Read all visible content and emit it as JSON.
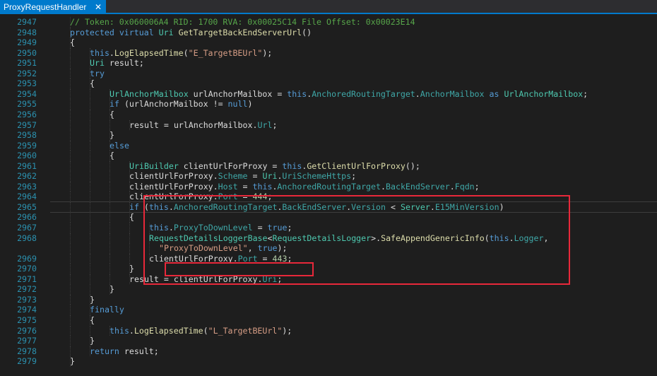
{
  "tab": {
    "title": "ProxyRequestHandler",
    "close": "✕"
  },
  "colors": {
    "comment": "#57a64a",
    "keyword": "#569cd6",
    "type": "#4ec9b0",
    "method": "#dcdcaa",
    "property": "#3fa8a8",
    "string": "#d69d85",
    "number": "#b5cea8",
    "plain": "#dcdcdc",
    "line_number": "#2b91af",
    "highlight_box": "#e8283a",
    "tab_accent": "#007acc"
  },
  "lines": [
    {
      "n": "2947",
      "indent": 2,
      "tokens": [
        [
          "cm",
          "// Token: 0x060006A4 RID: 1700 RVA: 0x00025C14 File Offset: 0x00023E14"
        ]
      ]
    },
    {
      "n": "2948",
      "indent": 2,
      "tokens": [
        [
          "kw",
          "protected"
        ],
        [
          "pl",
          " "
        ],
        [
          "kw",
          "virtual"
        ],
        [
          "pl",
          " "
        ],
        [
          "ty",
          "Uri"
        ],
        [
          "pl",
          " "
        ],
        [
          "mt",
          "GetTargetBackEndServerUrl"
        ],
        [
          "pl",
          "()"
        ]
      ]
    },
    {
      "n": "2949",
      "indent": 2,
      "tokens": [
        [
          "pl",
          "{"
        ]
      ]
    },
    {
      "n": "2950",
      "indent": 3,
      "tokens": [
        [
          "kw",
          "this"
        ],
        [
          "pl",
          "."
        ],
        [
          "mt",
          "LogElapsedTime"
        ],
        [
          "pl",
          "("
        ],
        [
          "st",
          "\"E_TargetBEUrl\""
        ],
        [
          "pl",
          ");"
        ]
      ]
    },
    {
      "n": "2951",
      "indent": 3,
      "tokens": [
        [
          "ty",
          "Uri"
        ],
        [
          "pl",
          " result;"
        ]
      ]
    },
    {
      "n": "2952",
      "indent": 3,
      "tokens": [
        [
          "kw",
          "try"
        ]
      ]
    },
    {
      "n": "2953",
      "indent": 3,
      "tokens": [
        [
          "pl",
          "{"
        ]
      ]
    },
    {
      "n": "2954",
      "indent": 4,
      "tokens": [
        [
          "ty",
          "UrlAnchorMailbox"
        ],
        [
          "pl",
          " urlAnchorMailbox = "
        ],
        [
          "kw",
          "this"
        ],
        [
          "pl",
          "."
        ],
        [
          "pr",
          "AnchoredRoutingTarget"
        ],
        [
          "pl",
          "."
        ],
        [
          "pr",
          "AnchorMailbox"
        ],
        [
          "pl",
          " "
        ],
        [
          "kw",
          "as"
        ],
        [
          "pl",
          " "
        ],
        [
          "ty",
          "UrlAnchorMailbox"
        ],
        [
          "pl",
          ";"
        ]
      ]
    },
    {
      "n": "2955",
      "indent": 4,
      "tokens": [
        [
          "kw",
          "if"
        ],
        [
          "pl",
          " (urlAnchorMailbox != "
        ],
        [
          "kw",
          "null"
        ],
        [
          "pl",
          ")"
        ]
      ]
    },
    {
      "n": "2956",
      "indent": 4,
      "tokens": [
        [
          "pl",
          "{"
        ]
      ]
    },
    {
      "n": "2957",
      "indent": 5,
      "tokens": [
        [
          "pl",
          "result = urlAnchorMailbox."
        ],
        [
          "pr",
          "Url"
        ],
        [
          "pl",
          ";"
        ]
      ]
    },
    {
      "n": "2958",
      "indent": 4,
      "tokens": [
        [
          "pl",
          "}"
        ]
      ]
    },
    {
      "n": "2959",
      "indent": 4,
      "tokens": [
        [
          "kw",
          "else"
        ]
      ]
    },
    {
      "n": "2960",
      "indent": 4,
      "tokens": [
        [
          "pl",
          "{"
        ]
      ]
    },
    {
      "n": "2961",
      "indent": 5,
      "tokens": [
        [
          "ty",
          "UriBuilder"
        ],
        [
          "pl",
          " clientUrlForProxy = "
        ],
        [
          "kw",
          "this"
        ],
        [
          "pl",
          "."
        ],
        [
          "mt",
          "GetClientUrlForProxy"
        ],
        [
          "pl",
          "();"
        ]
      ]
    },
    {
      "n": "2962",
      "indent": 5,
      "tokens": [
        [
          "pl",
          "clientUrlForProxy."
        ],
        [
          "pr",
          "Scheme"
        ],
        [
          "pl",
          " = "
        ],
        [
          "ty",
          "Uri"
        ],
        [
          "pl",
          "."
        ],
        [
          "pr",
          "UriSchemeHttps"
        ],
        [
          "pl",
          ";"
        ]
      ]
    },
    {
      "n": "2963",
      "indent": 5,
      "tokens": [
        [
          "pl",
          "clientUrlForProxy."
        ],
        [
          "pr",
          "Host"
        ],
        [
          "pl",
          " = "
        ],
        [
          "kw",
          "this"
        ],
        [
          "pl",
          "."
        ],
        [
          "pr",
          "AnchoredRoutingTarget"
        ],
        [
          "pl",
          "."
        ],
        [
          "pr",
          "BackEndServer"
        ],
        [
          "pl",
          "."
        ],
        [
          "pr",
          "Fqdn"
        ],
        [
          "pl",
          ";"
        ]
      ]
    },
    {
      "n": "2964",
      "indent": 5,
      "tokens": [
        [
          "pl",
          "clientUrlForProxy."
        ],
        [
          "pr",
          "Port"
        ],
        [
          "pl",
          " = "
        ],
        [
          "nm",
          "444"
        ],
        [
          "pl",
          ";"
        ]
      ]
    },
    {
      "n": "2965",
      "indent": 5,
      "tokens": [
        [
          "kw",
          "if"
        ],
        [
          "pl",
          " ("
        ],
        [
          "kw",
          "this"
        ],
        [
          "pl",
          "."
        ],
        [
          "pr",
          "AnchoredRoutingTarget"
        ],
        [
          "pl",
          "."
        ],
        [
          "pr",
          "BackEndServer"
        ],
        [
          "pl",
          "."
        ],
        [
          "pr",
          "Version"
        ],
        [
          "pl",
          " < "
        ],
        [
          "ty",
          "Server"
        ],
        [
          "pl",
          "."
        ],
        [
          "pr",
          "E15MinVersion"
        ],
        [
          "pl",
          ")"
        ]
      ]
    },
    {
      "n": "2966",
      "indent": 5,
      "tokens": [
        [
          "pl",
          "{"
        ]
      ]
    },
    {
      "n": "2967",
      "indent": 6,
      "tokens": [
        [
          "kw",
          "this"
        ],
        [
          "pl",
          "."
        ],
        [
          "pr",
          "ProxyToDownLevel"
        ],
        [
          "pl",
          " = "
        ],
        [
          "kw",
          "true"
        ],
        [
          "pl",
          ";"
        ]
      ]
    },
    {
      "n": "2968",
      "indent": 6,
      "tokens": [
        [
          "ty",
          "RequestDetailsLoggerBase"
        ],
        [
          "pl",
          "<"
        ],
        [
          "ty",
          "RequestDetailsLogger"
        ],
        [
          "pl",
          ">."
        ],
        [
          "mt",
          "SafeAppendGenericInfo"
        ],
        [
          "pl",
          "("
        ],
        [
          "kw",
          "this"
        ],
        [
          "pl",
          "."
        ],
        [
          "pr",
          "Logger"
        ],
        [
          "pl",
          ","
        ]
      ]
    },
    {
      "n": "",
      "indent": 6,
      "extra": 2,
      "tokens": [
        [
          "st",
          "\"ProxyToDownLevel\""
        ],
        [
          "pl",
          ", "
        ],
        [
          "kw",
          "true"
        ],
        [
          "pl",
          ");"
        ]
      ]
    },
    {
      "n": "2969",
      "indent": 6,
      "tokens": [
        [
          "pl",
          "clientUrlForProxy."
        ],
        [
          "pr",
          "Port"
        ],
        [
          "pl",
          " = "
        ],
        [
          "nm",
          "443"
        ],
        [
          "pl",
          ";"
        ]
      ]
    },
    {
      "n": "2970",
      "indent": 5,
      "tokens": [
        [
          "pl",
          "}"
        ]
      ]
    },
    {
      "n": "2971",
      "indent": 5,
      "tokens": [
        [
          "pl",
          "result = clientUrlForProxy."
        ],
        [
          "pr",
          "Uri"
        ],
        [
          "pl",
          ";"
        ]
      ]
    },
    {
      "n": "2972",
      "indent": 4,
      "tokens": [
        [
          "pl",
          "}"
        ]
      ]
    },
    {
      "n": "2973",
      "indent": 3,
      "tokens": [
        [
          "pl",
          "}"
        ]
      ]
    },
    {
      "n": "2974",
      "indent": 3,
      "tokens": [
        [
          "kw",
          "finally"
        ]
      ]
    },
    {
      "n": "2975",
      "indent": 3,
      "tokens": [
        [
          "pl",
          "{"
        ]
      ]
    },
    {
      "n": "2976",
      "indent": 4,
      "tokens": [
        [
          "kw",
          "this"
        ],
        [
          "pl",
          "."
        ],
        [
          "mt",
          "LogElapsedTime"
        ],
        [
          "pl",
          "("
        ],
        [
          "st",
          "\"L_TargetBEUrl\""
        ],
        [
          "pl",
          ");"
        ]
      ]
    },
    {
      "n": "2977",
      "indent": 3,
      "tokens": [
        [
          "pl",
          "}"
        ]
      ]
    },
    {
      "n": "2978",
      "indent": 3,
      "tokens": [
        [
          "kw",
          "return"
        ],
        [
          "pl",
          " result;"
        ]
      ]
    },
    {
      "n": "2979",
      "indent": 2,
      "tokens": [
        [
          "pl",
          "}"
        ]
      ]
    }
  ]
}
